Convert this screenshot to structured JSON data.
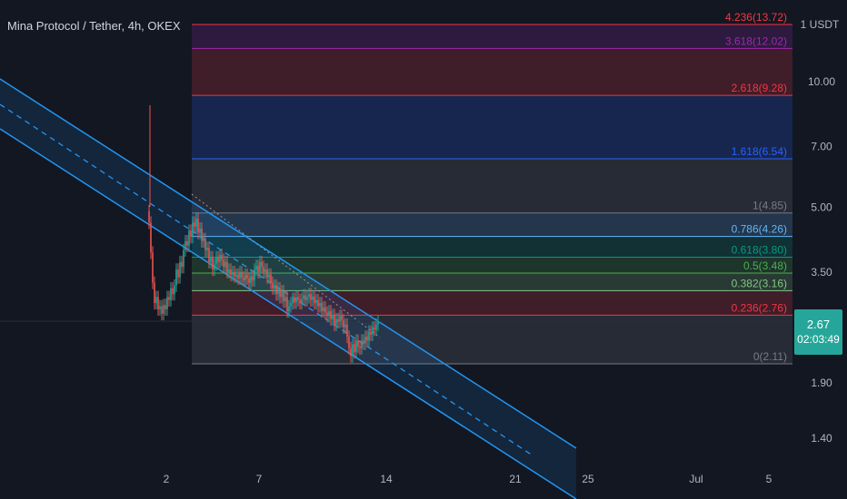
{
  "title": "Mina Protocol / Tether, 4h, OKEX",
  "current_price": {
    "value": "2.67",
    "countdown": "02:03:49",
    "color": "#26a69a"
  },
  "chart_data": {
    "type": "candlestick",
    "title": "Mina Protocol / Tether, 4h, OKEX",
    "y_axis": {
      "unit": "1 USDT",
      "scale": "log",
      "ticks": [
        "10.00",
        "7.00",
        "5.00",
        "3.50",
        "1.90",
        "1.40"
      ]
    },
    "x_axis": {
      "ticks": [
        "2",
        "7",
        "14",
        "21",
        "25",
        "Jul",
        "5"
      ]
    },
    "fibonacci_retracement": [
      {
        "level": 4.236,
        "price": 13.72,
        "label": "4.236(13.72)",
        "color": "#f23645"
      },
      {
        "level": 3.618,
        "price": 12.02,
        "label": "3.618(12.02)",
        "color": "#9c27b0"
      },
      {
        "level": 2.618,
        "price": 9.28,
        "label": "2.618(9.28)",
        "color": "#f23645"
      },
      {
        "level": 1.618,
        "price": 6.54,
        "label": "1.618(6.54)",
        "color": "#2962ff"
      },
      {
        "level": 1,
        "price": 4.85,
        "label": "1(4.85)",
        "color": "#787b86"
      },
      {
        "level": 0.786,
        "price": 4.26,
        "label": "0.786(4.26)",
        "color": "#64b5f6"
      },
      {
        "level": 0.618,
        "price": 3.8,
        "label": "0.618(3.80)",
        "color": "#089981"
      },
      {
        "level": 0.5,
        "price": 3.48,
        "label": "0.5(3.48)",
        "color": "#4caf50"
      },
      {
        "level": 0.382,
        "price": 3.16,
        "label": "0.382(3.16)",
        "color": "#81c784"
      },
      {
        "level": 0.236,
        "price": 2.76,
        "label": "0.236(2.76)",
        "color": "#f23645"
      },
      {
        "level": 0,
        "price": 2.11,
        "label": "0(2.11)",
        "color": "#787b86"
      }
    ],
    "candle_colors": {
      "up": "#26a69a",
      "down": "#ef5350"
    },
    "channel_color": "#2196f3",
    "last_price": 2.67
  }
}
